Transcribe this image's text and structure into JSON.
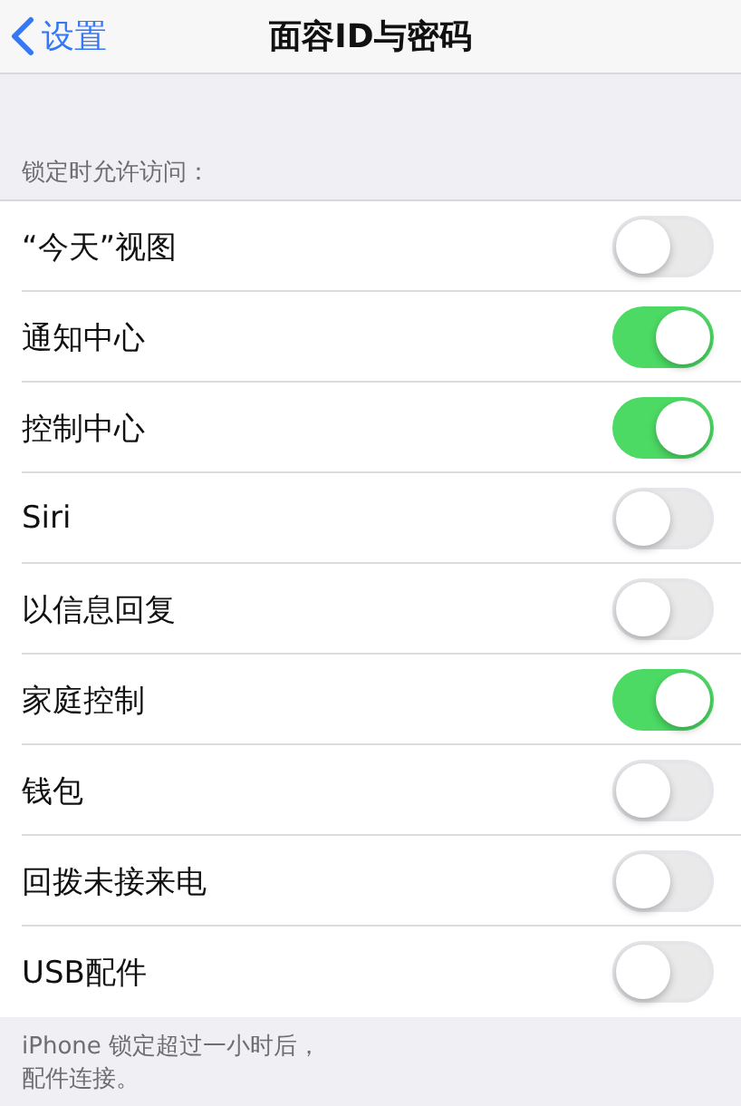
{
  "nav": {
    "back": "设置",
    "title": "面容ID与密码"
  },
  "section": {
    "header": "锁定时允许访问：",
    "rows": [
      {
        "label": "“今天”视图",
        "on": false
      },
      {
        "label": "通知中心",
        "on": true
      },
      {
        "label": "控制中心",
        "on": true
      },
      {
        "label": "Siri",
        "on": false
      },
      {
        "label": "以信息回复",
        "on": false
      },
      {
        "label": "家庭控制",
        "on": true
      },
      {
        "label": "钱包",
        "on": false
      },
      {
        "label": "回拨未接来电",
        "on": false
      },
      {
        "label": "USB配件",
        "on": false
      }
    ],
    "footer": [
      "iPhone 锁定超过一小时后，",
      "配件连接。"
    ]
  }
}
